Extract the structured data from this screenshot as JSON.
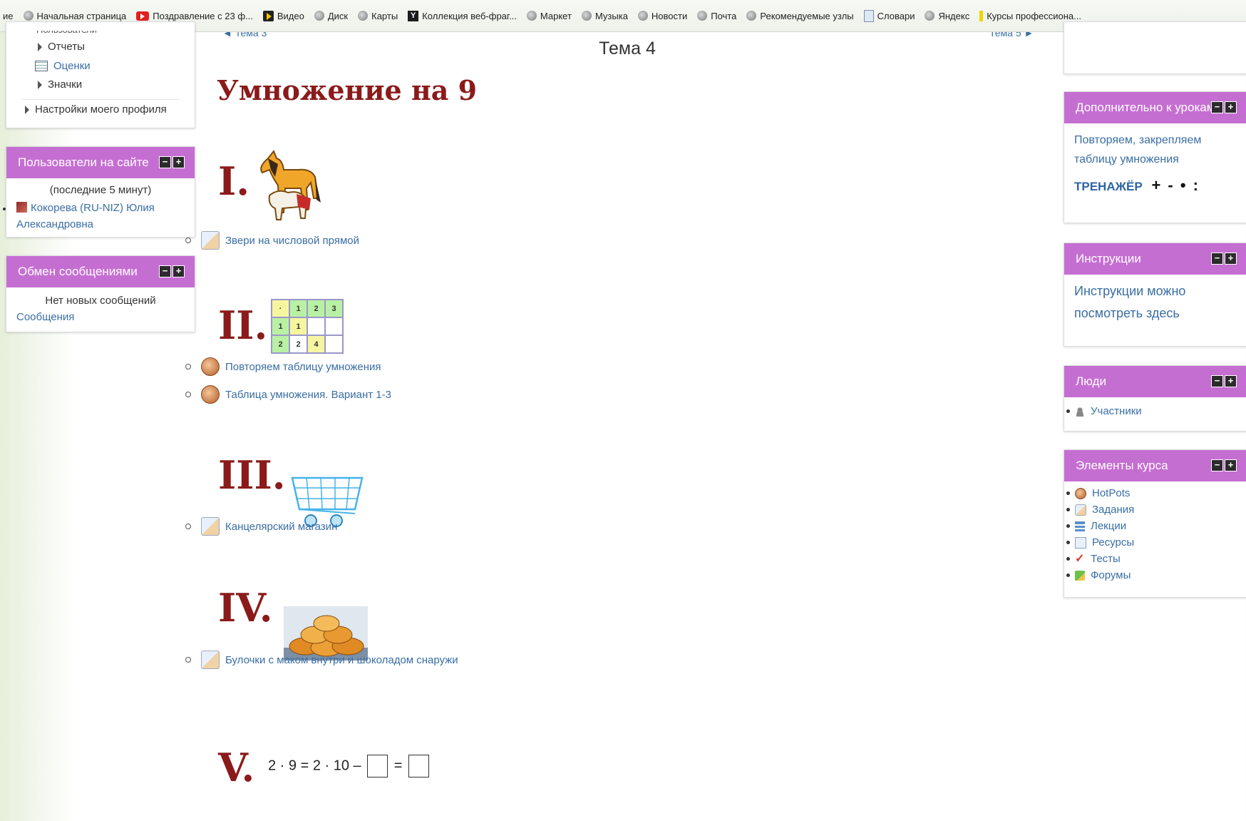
{
  "bookmarks": [
    {
      "label": "ие",
      "icon": "none"
    },
    {
      "label": "Начальная страница",
      "icon": "globe-icon"
    },
    {
      "label": "Поздравление с 23 ф...",
      "icon": "youtube-icon"
    },
    {
      "label": "Видео",
      "icon": "video-icon"
    },
    {
      "label": "Диск",
      "icon": "globe-icon"
    },
    {
      "label": "Карты",
      "icon": "globe-icon"
    },
    {
      "label": "Коллекция веб-фраг...",
      "icon": "yandex-collection-icon"
    },
    {
      "label": "Маркет",
      "icon": "globe-icon"
    },
    {
      "label": "Музыка",
      "icon": "globe-icon"
    },
    {
      "label": "Новости",
      "icon": "globe-icon"
    },
    {
      "label": "Почта",
      "icon": "globe-icon"
    },
    {
      "label": "Рекомендуемые узлы",
      "icon": "globe-icon"
    },
    {
      "label": "Словари",
      "icon": "document-icon"
    },
    {
      "label": "Яндекс",
      "icon": "globe-icon"
    },
    {
      "label": "Курсы профессиона...",
      "icon": "crayon-icon"
    }
  ],
  "left": {
    "nav": {
      "cut_item": "Пользователи",
      "reports": "Отчеты",
      "grades": "Оценки",
      "badges": "Значки",
      "profile_settings": "Настройки моего профиля"
    },
    "online": {
      "title": "Пользователи на сайте",
      "period": "(последние 5 минут)",
      "user": "Кокорева (RU-NIZ) Юлия Александровна"
    },
    "messages": {
      "title": "Обмен сообщениями",
      "status": "Нет новых сообщений",
      "link": "Сообщения"
    }
  },
  "center": {
    "section_title": "Тема 4",
    "prev": "◄ Тема 3",
    "next": "Тема 5 ►",
    "heading": "Умножение на 9",
    "parts": [
      {
        "numeral": "I.",
        "activities": [
          {
            "label": "Звери на числовой прямой",
            "icon": "assignment-icon"
          }
        ]
      },
      {
        "numeral": "II.",
        "activities": [
          {
            "label": "Повторяем таблицу умножения",
            "icon": "hotpot-icon"
          },
          {
            "label": "Таблица умножения. Вариант 1-3",
            "icon": "hotpot-icon"
          }
        ]
      },
      {
        "numeral": "III.",
        "activities": [
          {
            "label": "Канцелярский магазин",
            "icon": "assignment-icon"
          }
        ]
      },
      {
        "numeral": "IV.",
        "activities": [
          {
            "label": "Булочки с маком внутри и шоколадом снаружи",
            "icon": "assignment-icon"
          }
        ]
      },
      {
        "numeral": "V.",
        "activities": []
      }
    ],
    "mult_table": [
      [
        "·",
        "1",
        "2",
        "3"
      ],
      [
        "1",
        "1",
        "",
        ""
      ],
      [
        "2",
        "2",
        "4",
        ""
      ]
    ],
    "equation": {
      "left": "2 · 9 = 2 · 10 –",
      "mid": "="
    }
  },
  "right": {
    "extra": {
      "title": "Дополнительно к урокам",
      "link": "Повторяем, закрепляем таблицу умножения",
      "trainer": "ТРЕНАЖЁР",
      "ops": "+ - • :"
    },
    "instructions": {
      "title": "Инструкции",
      "link": "Инструкции можно посмотреть здесь"
    },
    "people": {
      "title": "Люди",
      "participants": "Участники"
    },
    "course_elements": {
      "title": "Элементы курса",
      "items": [
        "HotPots",
        "Задания",
        "Лекции",
        "Ресурсы",
        "Тесты",
        "Форумы"
      ]
    }
  },
  "colors": {
    "block_header": "#c56ed2",
    "link": "#3a6ea5",
    "heading": "#8b1a1a"
  }
}
